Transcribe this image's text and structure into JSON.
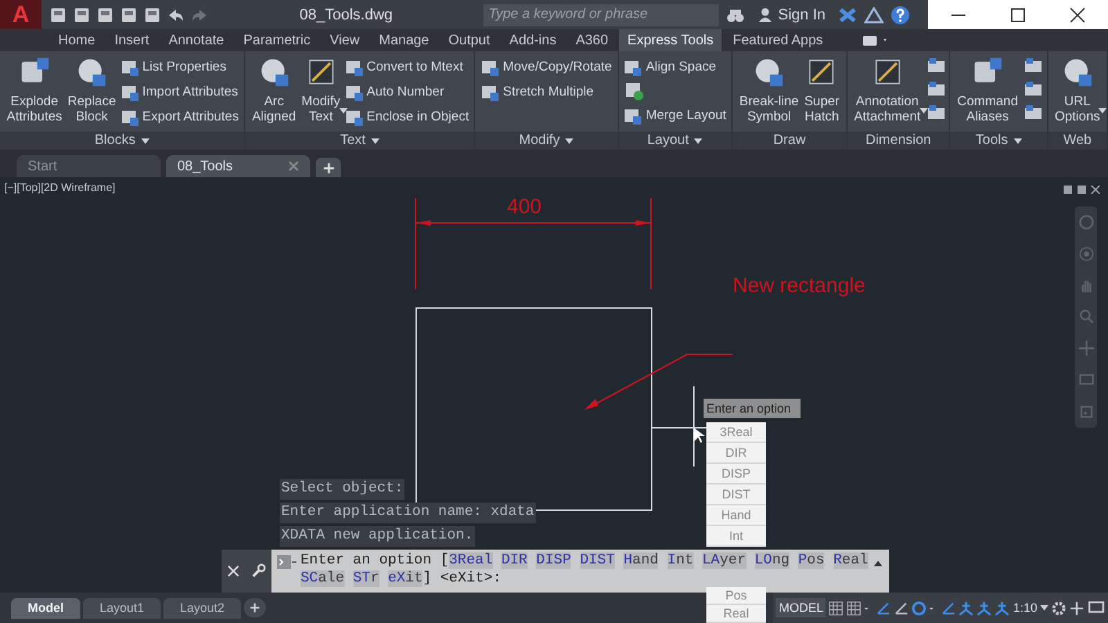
{
  "app_button": {
    "label": "A"
  },
  "title_bar": {
    "title": "08_Tools.dwg",
    "search": {
      "placeholder": "Type a keyword or phrase"
    },
    "sign_in": "Sign In"
  },
  "ribbon_tabs": [
    {
      "label": "Home",
      "selected": false
    },
    {
      "label": "Insert",
      "selected": false
    },
    {
      "label": "Annotate",
      "selected": false
    },
    {
      "label": "Parametric",
      "selected": false
    },
    {
      "label": "View",
      "selected": false
    },
    {
      "label": "Manage",
      "selected": false
    },
    {
      "label": "Output",
      "selected": false
    },
    {
      "label": "Add-ins",
      "selected": false
    },
    {
      "label": "A360",
      "selected": false
    },
    {
      "label": "Express Tools",
      "selected": true
    },
    {
      "label": "Featured Apps",
      "selected": false
    }
  ],
  "ribbon_panels": [
    {
      "title": "Blocks",
      "menu": true,
      "items": [
        {
          "kind": "large",
          "label": "Explode\nAttributes",
          "dropdown": false
        },
        {
          "kind": "large",
          "label": "Replace\nBlock",
          "dropdown": false
        },
        {
          "kind": "small",
          "buttons": [
            {
              "kind": "labeled",
              "label": "List Properties"
            },
            {
              "kind": "labeled",
              "label": "Import Attributes"
            },
            {
              "kind": "labeled",
              "label": "Export Attributes"
            }
          ]
        }
      ]
    },
    {
      "title": "Text",
      "menu": true,
      "items": [
        {
          "kind": "large",
          "label": "Arc\nAligned",
          "dropdown": false
        },
        {
          "kind": "large",
          "label": "Modify\nText",
          "dropdown": true
        },
        {
          "kind": "small",
          "buttons": [
            {
              "kind": "labeled",
              "label": "Convert to Mtext"
            },
            {
              "kind": "labeled",
              "label": "Auto Number"
            },
            {
              "kind": "labeled",
              "label": "Enclose in Object"
            }
          ]
        }
      ]
    },
    {
      "title": "Modify",
      "menu": true,
      "items": [
        {
          "kind": "small",
          "buttons": [
            {
              "kind": "labeled",
              "label": "Move/Copy/Rotate"
            },
            {
              "kind": "labeled",
              "label": "Stretch Multiple"
            }
          ]
        }
      ]
    },
    {
      "title": "Layout",
      "menu": true,
      "items": [
        {
          "kind": "small",
          "buttons": [
            {
              "kind": "labeled",
              "label": "Align Space"
            },
            {
              "kind": "icon"
            },
            {
              "kind": "labeled",
              "label": "Merge Layout"
            }
          ]
        }
      ]
    },
    {
      "title": "Draw",
      "menu": false,
      "items": [
        {
          "kind": "large",
          "label": "Break-line\nSymbol",
          "dropdown": false
        },
        {
          "kind": "large",
          "label": "Super\nHatch",
          "dropdown": false
        }
      ]
    },
    {
      "title": "Dimension",
      "menu": false,
      "items": [
        {
          "kind": "large",
          "label": "Annotation\nAttachment",
          "dropdown": true
        },
        {
          "kind": "icons"
        }
      ]
    },
    {
      "title": "Tools",
      "menu": true,
      "items": [
        {
          "kind": "large",
          "label": "Command\nAliases",
          "dropdown": false
        },
        {
          "kind": "icons"
        }
      ]
    },
    {
      "title": "Web",
      "menu": false,
      "items": [
        {
          "kind": "large",
          "label": "URL\nOptions",
          "dropdown": true
        }
      ]
    }
  ],
  "file_tabs": [
    {
      "label": "Start",
      "selected": false,
      "closable": false
    },
    {
      "label": "08_Tools",
      "selected": true,
      "closable": true
    }
  ],
  "viewport": {
    "label": "[−][Top][2D Wireframe]",
    "dimension": "400",
    "annotation": "New rectangle",
    "history": [
      "Select object:",
      "Enter application name: xdata",
      "XDATA new application."
    ],
    "tooltip": "Enter an option",
    "options_upper": [
      "3Real",
      "DIR",
      "DISP",
      "DIST",
      "Hand",
      "Int"
    ],
    "options_lower": [
      "Pos",
      "Real"
    ]
  },
  "command_line": {
    "prefix": "Enter an option [",
    "options": [
      {
        "key": "3Real"
      },
      {
        "key": "DIR"
      },
      {
        "key": "DISP"
      },
      {
        "key": "DIST"
      },
      {
        "key": "H",
        "rest": "and"
      },
      {
        "key": "I",
        "rest": "nt"
      },
      {
        "key": "LA",
        "rest": "yer"
      },
      {
        "key": "LO",
        "rest": "ng"
      },
      {
        "key": "P",
        "rest": "os"
      },
      {
        "key": "R",
        "rest": "eal"
      },
      {
        "key": "SC",
        "rest": "ale"
      },
      {
        "key": "ST",
        "rest": "r"
      },
      {
        "key": "eX",
        "rest": "it"
      }
    ],
    "suffix": "] <eXit>:"
  },
  "layout_tabs": [
    {
      "label": "Model",
      "selected": true
    },
    {
      "label": "Layout1",
      "selected": false
    },
    {
      "label": "Layout2",
      "selected": false
    }
  ],
  "status_bar": {
    "mode": "MODEL",
    "scale": "1:10"
  }
}
